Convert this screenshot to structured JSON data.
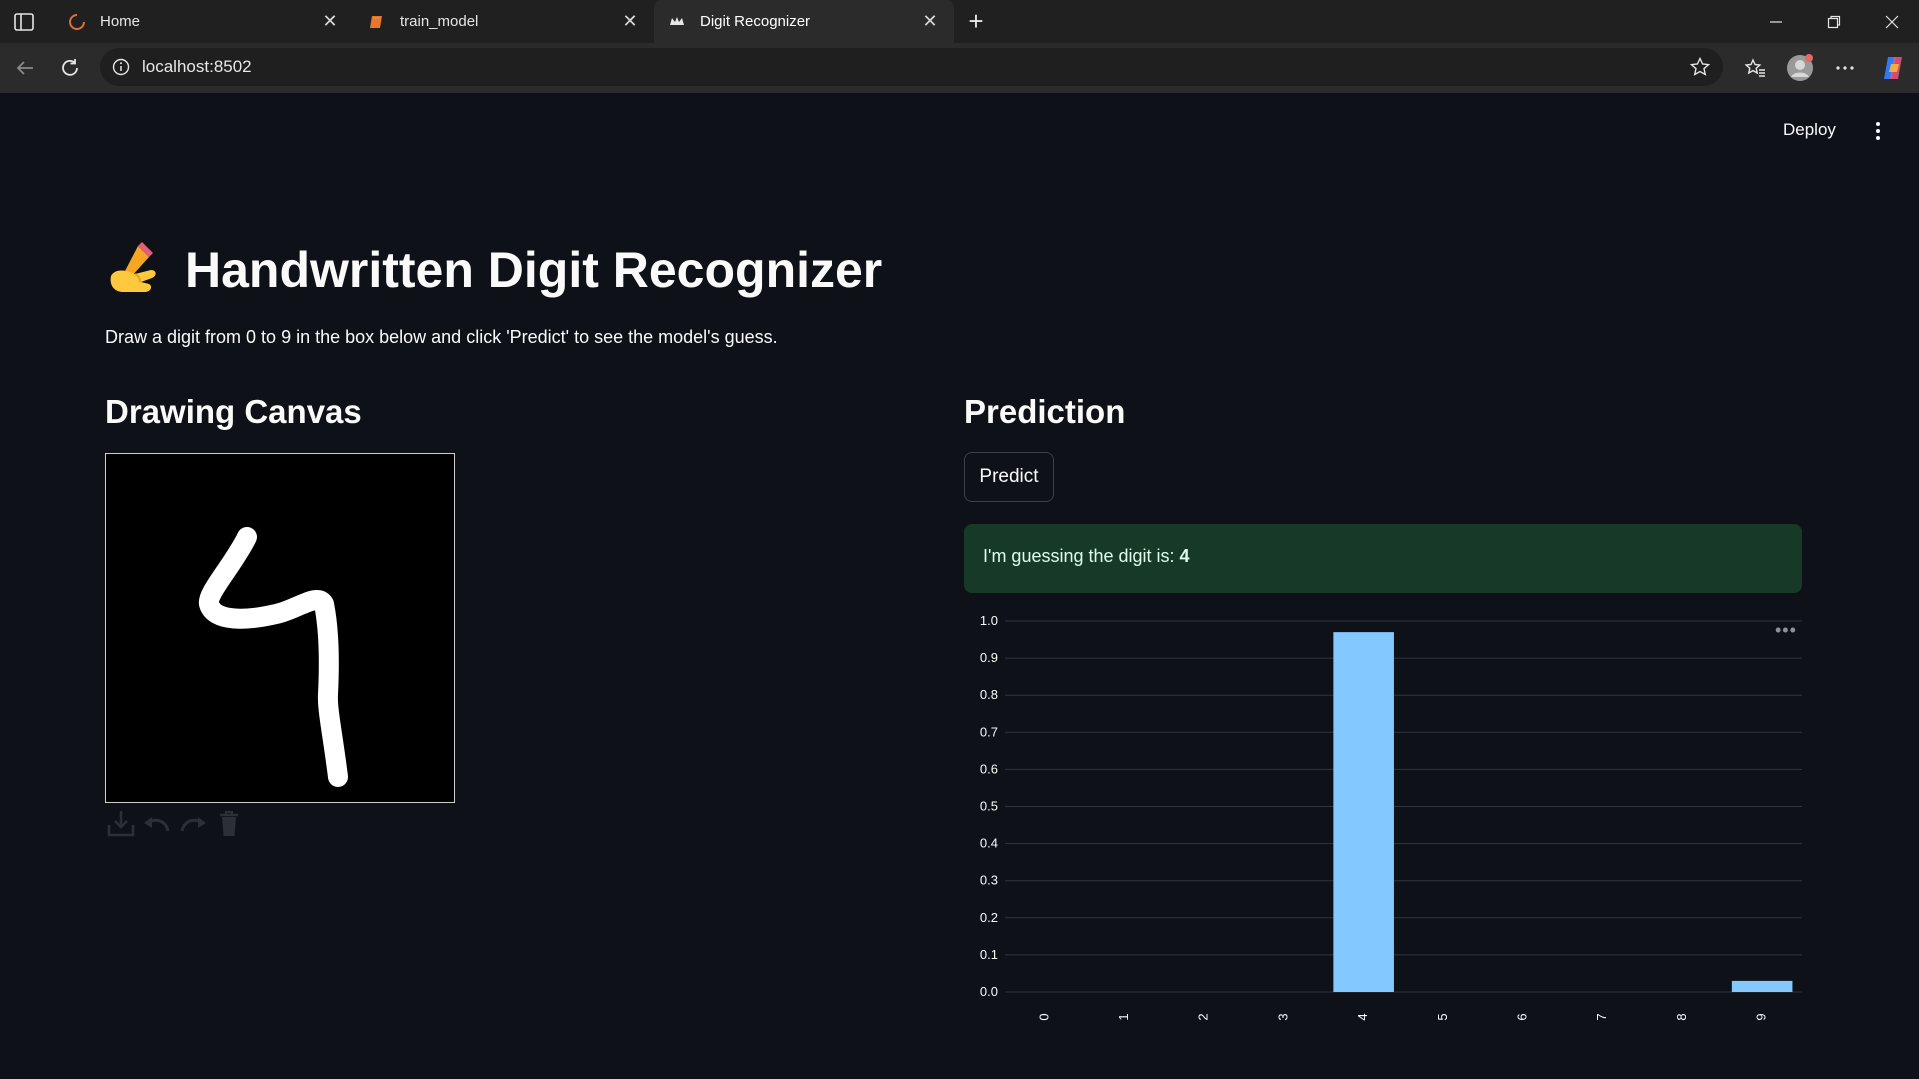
{
  "browser": {
    "tabs": [
      {
        "title": "Home",
        "icon": "loading-icon",
        "active": false
      },
      {
        "title": "train_model",
        "icon": "notebook-icon",
        "active": false
      },
      {
        "title": "Digit Recognizer",
        "icon": "streamlit-crown-icon",
        "active": true
      }
    ],
    "url": "localhost:8502"
  },
  "header": {
    "deploy_label": "Deploy"
  },
  "main": {
    "title": "Handwritten Digit Recognizer",
    "title_emoji": "✍️",
    "description": "Draw a digit from 0 to 9 in the box below and click 'Predict' to see the model's guess.",
    "canvas_heading": "Drawing Canvas",
    "prediction_heading": "Prediction",
    "predict_label": "Predict",
    "result_prefix": "I'm guessing the digit is: ",
    "result_digit": "4"
  },
  "colors": {
    "bar": "#83c9ff",
    "success_bg": "#173928",
    "page_bg": "#0e1117"
  },
  "chart_data": {
    "type": "bar",
    "categories": [
      "0",
      "1",
      "2",
      "3",
      "4",
      "5",
      "6",
      "7",
      "8",
      "9"
    ],
    "values": [
      0.0,
      0.0,
      0.0,
      0.0,
      0.97,
      0.0,
      0.0,
      0.0,
      0.0,
      0.03
    ],
    "ylim": [
      0,
      1.0
    ],
    "yticks": [
      "0.0",
      "0.1",
      "0.2",
      "0.3",
      "0.4",
      "0.5",
      "0.6",
      "0.7",
      "0.8",
      "0.9",
      "1.0"
    ],
    "grid": true,
    "xlabel": "",
    "ylabel": "",
    "title": ""
  }
}
